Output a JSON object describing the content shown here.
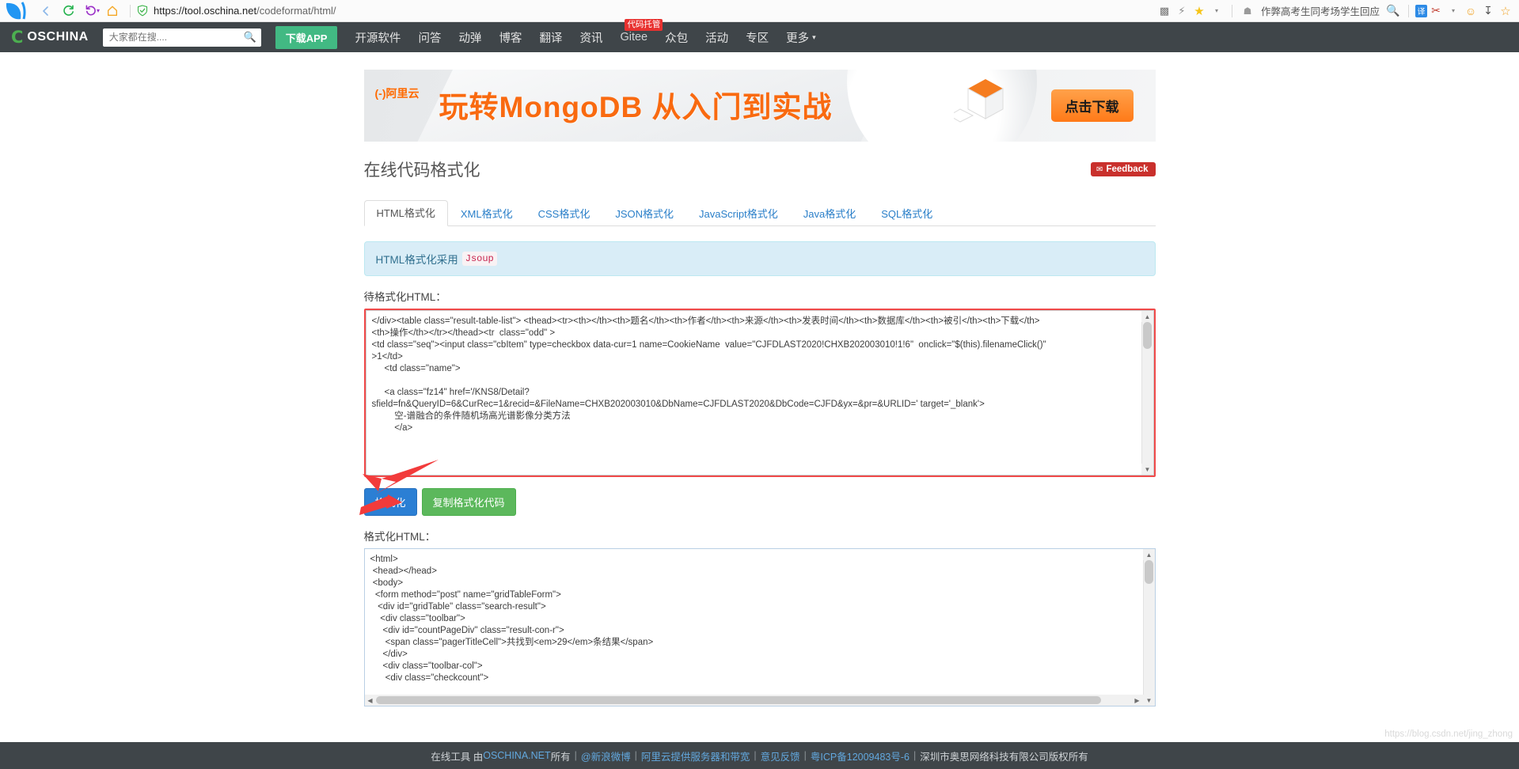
{
  "browser": {
    "url_scheme_host": "https://tool.oschina.net",
    "url_path": "/codeformat/html/",
    "back_icon": "back-arrow-icon",
    "reload_icon": "reload-icon",
    "history_icon": "history-icon",
    "home_icon": "home-icon",
    "shield_icon": "shield-icon",
    "right_items": [
      {
        "name": "qr-code-icon",
        "glyph": "▩"
      },
      {
        "name": "lightning-icon",
        "glyph": "⚡"
      },
      {
        "name": "favorite-star-icon",
        "glyph": "★"
      },
      {
        "name": "chevron-down-icon",
        "glyph": "▾"
      },
      {
        "name": "incognito-icon",
        "glyph": "☠"
      }
    ],
    "news_text": "作弊高考生同考场学生回应",
    "search_icon": "search-icon",
    "translate_icon": "译",
    "scissors_icon": "✂",
    "smiley_icon": "☺",
    "download_icon": "↓",
    "bookmark_star_icon": "☆"
  },
  "site_header": {
    "brand_mark": "C",
    "brand_name": "OSCHINA",
    "search_placeholder": "大家都在搜....",
    "search_value": "",
    "search_icon": "search-icon",
    "download_app_label": "下载APP",
    "nav": [
      {
        "label": "开源软件",
        "name": "nav-opensource"
      },
      {
        "label": "问答",
        "name": "nav-qa"
      },
      {
        "label": "动弹",
        "name": "nav-tweet"
      },
      {
        "label": "博客",
        "name": "nav-blog"
      },
      {
        "label": "翻译",
        "name": "nav-translate"
      },
      {
        "label": "资讯",
        "name": "nav-news"
      },
      {
        "label": "Gitee",
        "name": "nav-gitee",
        "badge": "代码托管"
      },
      {
        "label": "众包",
        "name": "nav-crowdsourcing"
      },
      {
        "label": "活动",
        "name": "nav-events"
      },
      {
        "label": "专区",
        "name": "nav-zone"
      }
    ],
    "more_label": "更多",
    "more_caret": "▾"
  },
  "banner": {
    "sponsor": "(-)阿里云",
    "title": "玩转MongoDB 从入门到实战",
    "button_label": "点击下载"
  },
  "main": {
    "page_title": "在线代码格式化",
    "feedback_label": "Feedback",
    "feedback_icon": "envelope-icon",
    "tabs": [
      {
        "label": "HTML格式化",
        "active": true,
        "name": "tab-html"
      },
      {
        "label": "XML格式化",
        "active": false,
        "name": "tab-xml"
      },
      {
        "label": "CSS格式化",
        "active": false,
        "name": "tab-css"
      },
      {
        "label": "JSON格式化",
        "active": false,
        "name": "tab-json"
      },
      {
        "label": "JavaScript格式化",
        "active": false,
        "name": "tab-javascript"
      },
      {
        "label": "Java格式化",
        "active": false,
        "name": "tab-java"
      },
      {
        "label": "SQL格式化",
        "active": false,
        "name": "tab-sql"
      }
    ],
    "alert_text": "HTML格式化采用",
    "alert_code": "Jsoup",
    "input_label": "待格式化HTML：",
    "input_value": "</div><table class=\"result-table-list\"> <thead><tr><th></th><th>题名</th><th>作者</th><th>来源</th><th>发表时间</th><th>数据库</th><th>被引</th><th>下载</th>\n<th>操作</th></tr></thead><tr  class=\"odd\" >\n<td class=\"seq\"><input class=\"cbItem\" type=checkbox data-cur=1 name=CookieName  value=\"CJFDLAST2020!CHXB202003010!1!6\"  onclick=\"$(this).filenameClick()\"\n>1</td>\n     <td class=\"name\">\n\n     <a class=\"fz14\" href='/KNS8/Detail?\nsfield=fn&QueryID=6&CurRec=1&recid=&FileName=CHXB202003010&DbName=CJFDLAST2020&DbCode=CJFD&yx=&pr=&URLID=' target='_blank'>\n         空-谱融合的条件随机场高光谱影像分类方法\n         </a>",
    "format_button": "格式化",
    "copy_button": "复制格式化代码",
    "output_label": "格式化HTML：",
    "output_value": "<html>\n <head></head>\n <body>\n  <form method=\"post\" name=\"gridTableForm\">\n   <div id=\"gridTable\" class=\"search-result\">\n    <div class=\"toolbar\">\n     <div id=\"countPageDiv\" class=\"result-con-r\">\n      <span class=\"pagerTitleCell\">共找到<em>29</em>条结果</span>\n     </div>\n     <div class=\"toolbar-col\">\n      <div class=\"checkcount\">"
  },
  "footer": {
    "prefix": "在线工具 由 ",
    "link_oschina": "OSCHINA.NET",
    "after_oschina": " 所有",
    "link_weibo": "@新浪微博",
    "link_aliyun": "阿里云提供服务器和带宽",
    "link_feedback": "意见反馈",
    "link_icp": "粤ICP备12009483号-6",
    "company": "深圳市奥思网络科技有限公司版权所有"
  },
  "watermark": "https://blog.csdn.net/jing_zhong"
}
